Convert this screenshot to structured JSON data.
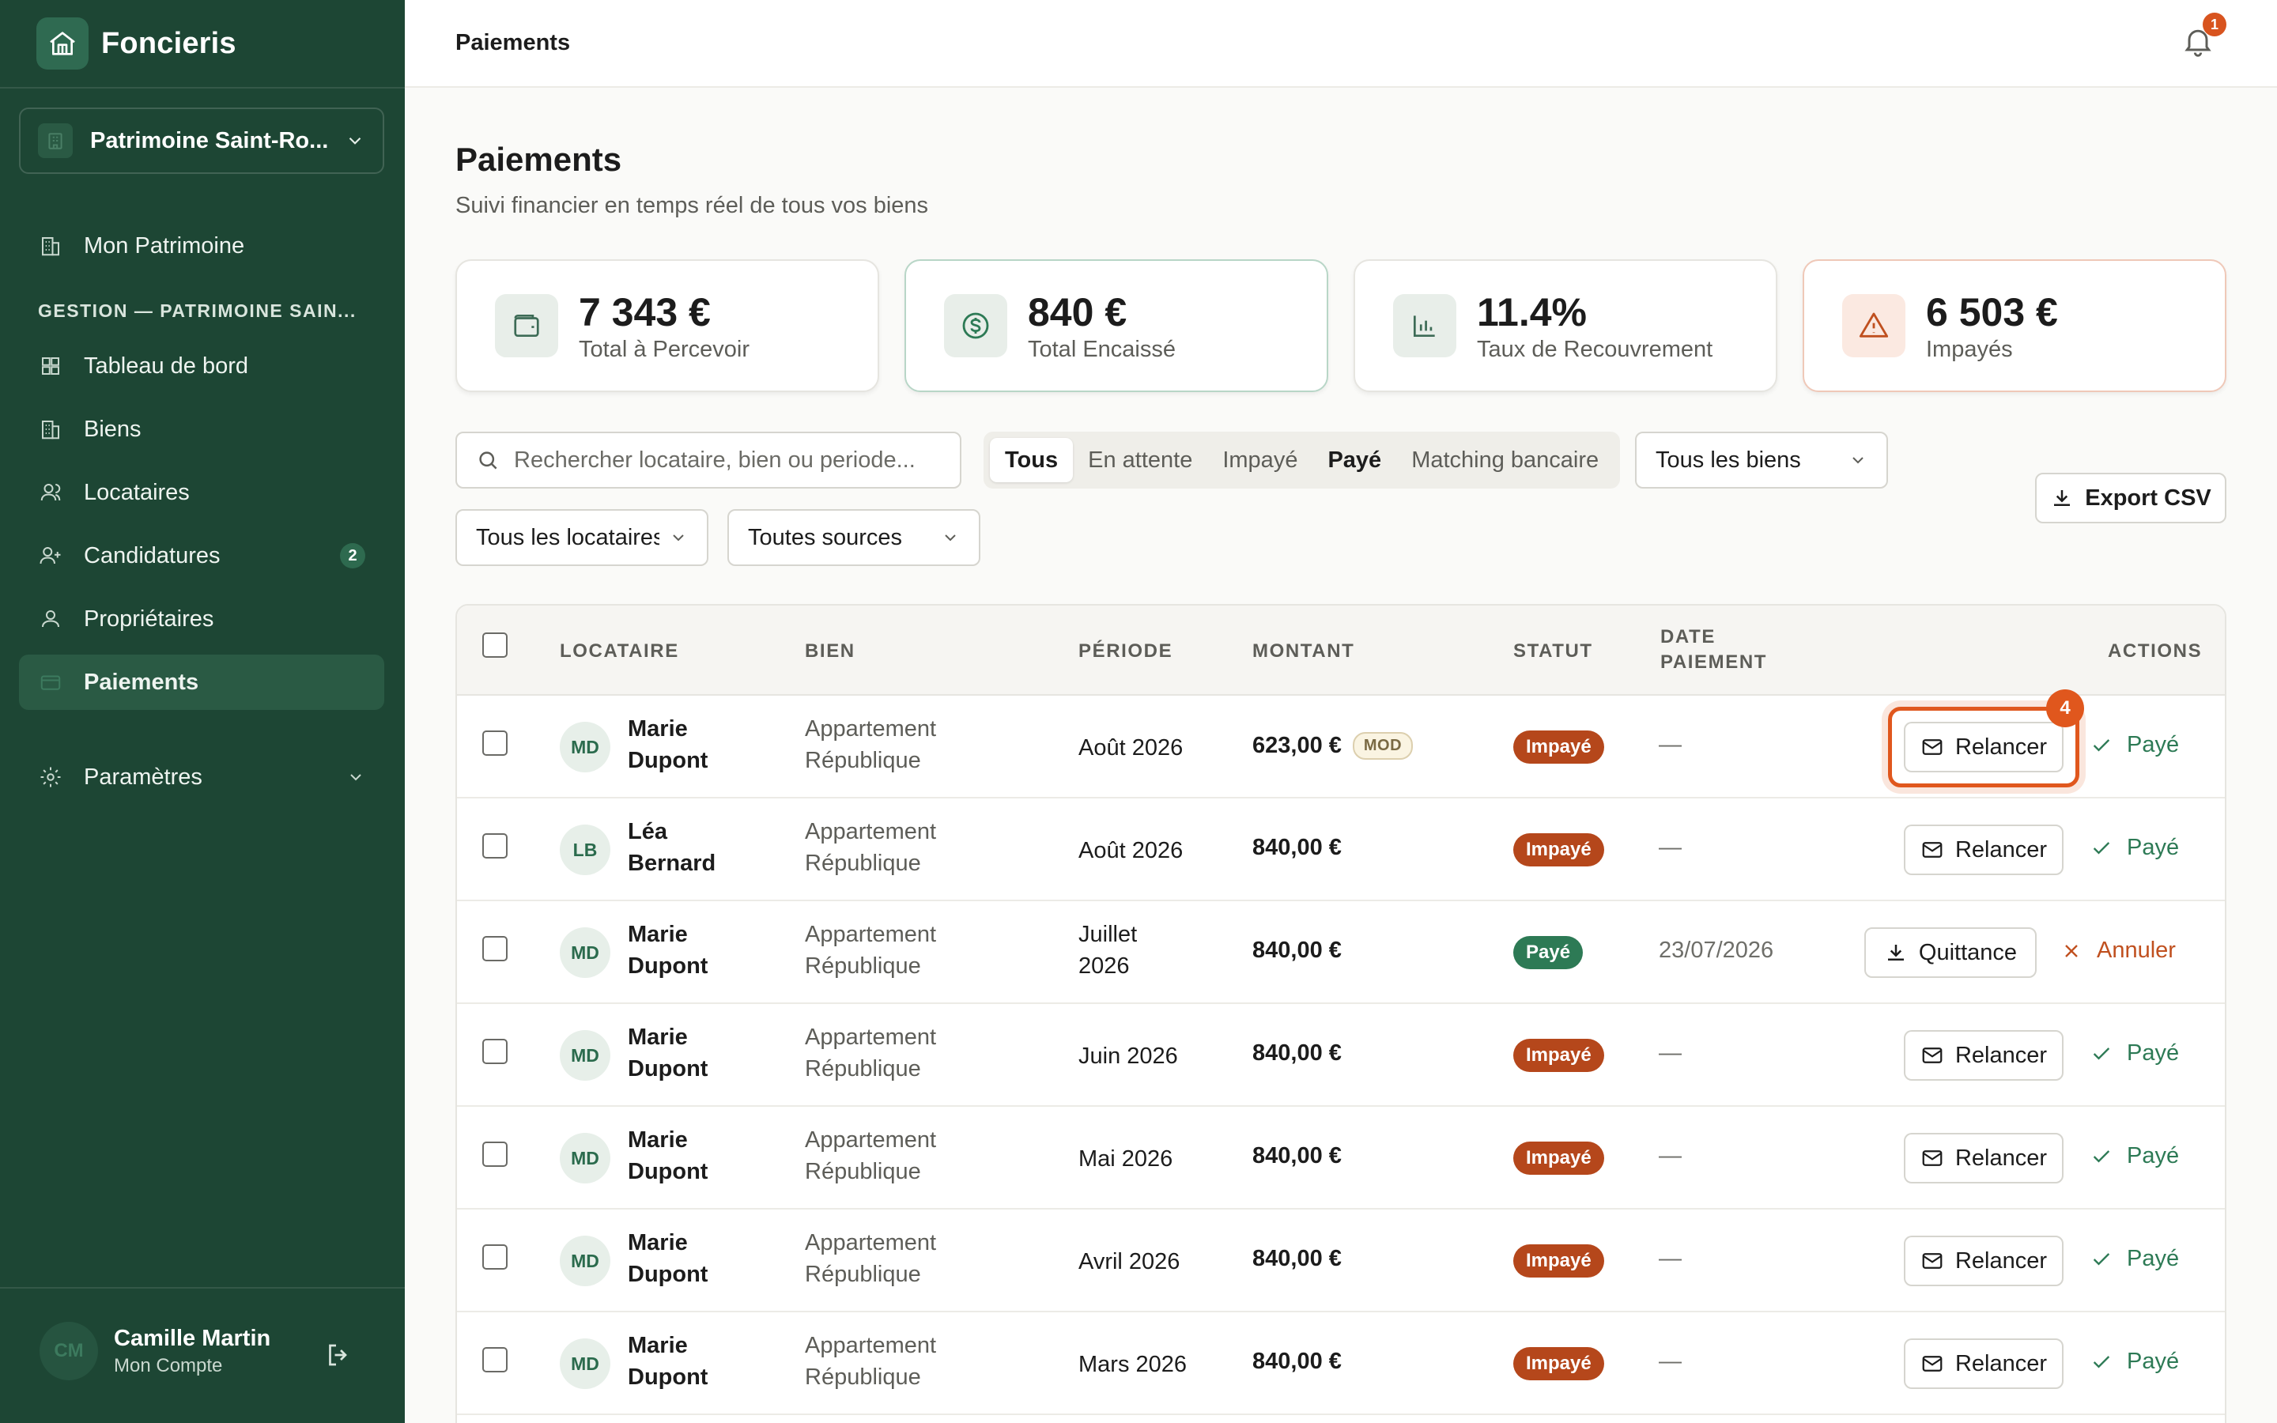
{
  "app": {
    "name": "Foncieris"
  },
  "org": {
    "name": "Patrimoine Saint-Ro..."
  },
  "nav": {
    "top_item": "Mon Patrimoine",
    "section": "GESTION — PATRIMOINE SAIN...",
    "items": [
      {
        "label": "Tableau de bord",
        "icon": "dashboard-icon"
      },
      {
        "label": "Biens",
        "icon": "building-icon"
      },
      {
        "label": "Locataires",
        "icon": "users-icon"
      },
      {
        "label": "Candidatures",
        "icon": "user-plus-icon",
        "badge": "2"
      },
      {
        "label": "Propriétaires",
        "icon": "user-icon"
      },
      {
        "label": "Paiements",
        "icon": "card-icon",
        "active": true
      }
    ],
    "settings": "Paramètres"
  },
  "user": {
    "initials": "CM",
    "name": "Camille Martin",
    "subtitle": "Mon Compte"
  },
  "topbar": {
    "breadcrumb": "Paiements",
    "notifications": "1"
  },
  "header": {
    "title": "Paiements",
    "subtitle": "Suivi financier en temps réel de tous vos biens"
  },
  "stats": [
    {
      "value": "7 343 €",
      "label": "Total à Percevoir",
      "icon": "wallet-icon"
    },
    {
      "value": "840 €",
      "label": "Total Encaissé",
      "icon": "dollar-icon"
    },
    {
      "value": "11.4%",
      "label": "Taux de Recouvrement",
      "icon": "bar-chart-icon"
    },
    {
      "value": "6 503 €",
      "label": "Impayés",
      "icon": "warning-icon"
    }
  ],
  "filters": {
    "search_placeholder": "Rechercher locataire, bien ou periode...",
    "tabs": [
      "Tous",
      "En attente",
      "Impayé",
      "Payé",
      "Matching bancaire"
    ],
    "active_tab": "Tous",
    "biens": "Tous les biens",
    "locataires": "Tous les locataires",
    "sources": "Toutes sources",
    "export": "Export CSV"
  },
  "table": {
    "headers": {
      "locataire": "LOCATAIRE",
      "bien": "BIEN",
      "periode": "PÉRIODE",
      "montant": "MONTANT",
      "statut": "STATUT",
      "date1": "DATE",
      "date2": "PAIEMENT",
      "actions": "ACTIONS"
    },
    "mod_label": "MOD",
    "relancer": "Relancer",
    "marquer_paye": "Payé",
    "quittance": "Quittance",
    "annuler": "Annuler",
    "focus_count": "4",
    "rows": [
      {
        "initials": "MD",
        "name": "Marie Dupont",
        "bien": "Appartement République",
        "periode": "Août 2026",
        "montant": "623,00 €",
        "status": "Impayé",
        "date": "—"
      },
      {
        "initials": "LB",
        "name": "Léa Bernard",
        "bien": "Appartement République",
        "periode": "Août 2026",
        "montant": "840,00 €",
        "status": "Impayé",
        "date": "—"
      },
      {
        "initials": "MD",
        "name": "Marie Dupont",
        "bien": "Appartement République",
        "periode": "Juillet 2026",
        "montant": "840,00 €",
        "status": "Payé",
        "date": "23/07/2026"
      },
      {
        "initials": "MD",
        "name": "Marie Dupont",
        "bien": "Appartement République",
        "periode": "Juin 2026",
        "montant": "840,00 €",
        "status": "Impayé",
        "date": "—"
      },
      {
        "initials": "MD",
        "name": "Marie Dupont",
        "bien": "Appartement République",
        "periode": "Mai 2026",
        "montant": "840,00 €",
        "status": "Impayé",
        "date": "—"
      },
      {
        "initials": "MD",
        "name": "Marie Dupont",
        "bien": "Appartement République",
        "periode": "Avril 2026",
        "montant": "840,00 €",
        "status": "Impayé",
        "date": "—"
      },
      {
        "initials": "MD",
        "name": "Marie Dupont",
        "bien": "Appartement République",
        "periode": "Mars 2026",
        "montant": "840,00 €",
        "status": "Impayé",
        "date": "—"
      }
    ]
  }
}
